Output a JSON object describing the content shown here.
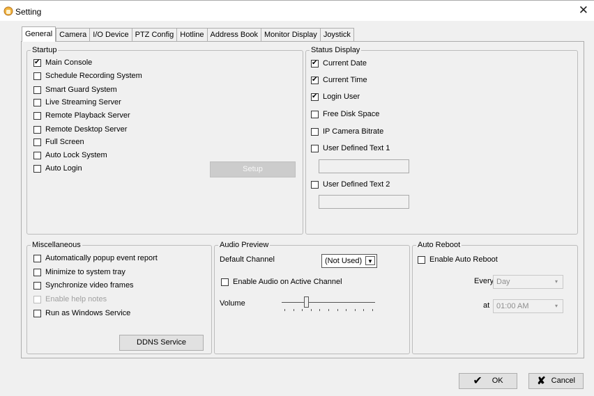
{
  "window": {
    "title": "Setting",
    "close_glyph": "✕"
  },
  "tabs": [
    {
      "label": "General",
      "active": true
    },
    {
      "label": "Camera"
    },
    {
      "label": "I/O Device"
    },
    {
      "label": "PTZ Config"
    },
    {
      "label": "Hotline"
    },
    {
      "label": "Address Book"
    },
    {
      "label": "Monitor Display"
    },
    {
      "label": "Joystick"
    }
  ],
  "startup": {
    "title": "Startup",
    "items": [
      {
        "label": "Main Console",
        "checked": true
      },
      {
        "label": "Schedule Recording System",
        "checked": false
      },
      {
        "label": "Smart Guard System",
        "checked": false
      },
      {
        "label": "Live Streaming Server",
        "checked": false
      },
      {
        "label": "Remote Playback Server",
        "checked": false
      },
      {
        "label": "Remote Desktop Server",
        "checked": false
      },
      {
        "label": "Full Screen",
        "checked": false
      },
      {
        "label": "Auto Lock System",
        "checked": false
      },
      {
        "label": "Auto Login",
        "checked": false
      }
    ],
    "setup_label": "Setup"
  },
  "status_display": {
    "title": "Status Display",
    "items": [
      {
        "label": "Current Date",
        "checked": true
      },
      {
        "label": "Current Time",
        "checked": true
      },
      {
        "label": "Login User",
        "checked": true
      },
      {
        "label": "Free Disk Space",
        "checked": false
      },
      {
        "label": "IP Camera Bitrate",
        "checked": false
      },
      {
        "label": "User Defined Text 1",
        "checked": false
      },
      {
        "label": "User Defined Text 2",
        "checked": false
      }
    ],
    "text1_value": "",
    "text2_value": ""
  },
  "misc": {
    "title": "Miscellaneous",
    "items": [
      {
        "label": "Automatically popup event report",
        "checked": false,
        "enabled": true
      },
      {
        "label": "Minimize to system tray",
        "checked": false,
        "enabled": true
      },
      {
        "label": "Synchronize video frames",
        "checked": false,
        "enabled": true
      },
      {
        "label": "Enable help notes",
        "checked": false,
        "enabled": false
      },
      {
        "label": "Run as Windows Service",
        "checked": false,
        "enabled": true
      }
    ],
    "ddns_label": "DDNS Service"
  },
  "audio": {
    "title": "Audio Preview",
    "default_channel_label": "Default Channel",
    "default_channel_value": "(Not Used)",
    "enable_active_label": "Enable Audio on Active Channel",
    "enable_active_checked": false,
    "volume_label": "Volume",
    "volume_level": 0.25
  },
  "reboot": {
    "title": "Auto Reboot",
    "enable_label": "Enable Auto Reboot",
    "enable_checked": false,
    "every_label": "Every",
    "every_value": "Day",
    "at_label": "at",
    "at_value": "01:00 AM"
  },
  "footer": {
    "ok_label": "OK",
    "cancel_label": "Cancel"
  },
  "icons": {
    "app": "settings-hand-icon",
    "ok": "checkmark-icon",
    "cancel": "x-icon",
    "close": "close-icon",
    "dropdown": "chevron-down-icon"
  },
  "colors": {
    "window_bg": "#f0f0f0",
    "titlebar_bg": "#ffffff",
    "disabled_button": "#cccccc"
  }
}
